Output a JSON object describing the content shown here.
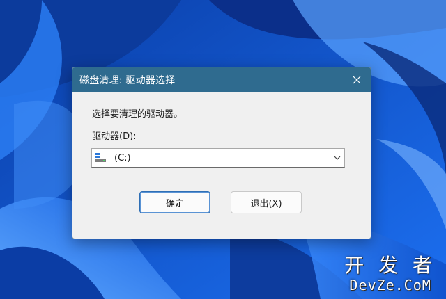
{
  "dialog": {
    "title": "磁盘清理: 驱动器选择",
    "prompt": "选择要清理的驱动器。",
    "drive_label": "驱动器(D):",
    "selected_drive": "(C:)",
    "ok_label": "确定",
    "exit_label": "退出(X)",
    "icons": {
      "close": "close-icon",
      "drive": "drive-icon",
      "dropdown": "chevron-down-icon"
    }
  },
  "watermark": {
    "line1": "开 发 者",
    "line2": "DevZe.CoM"
  },
  "colors": {
    "titlebar": "#2f6b8f",
    "dialog_bg": "#f0f0f0",
    "desktop": "#1f63d6"
  }
}
